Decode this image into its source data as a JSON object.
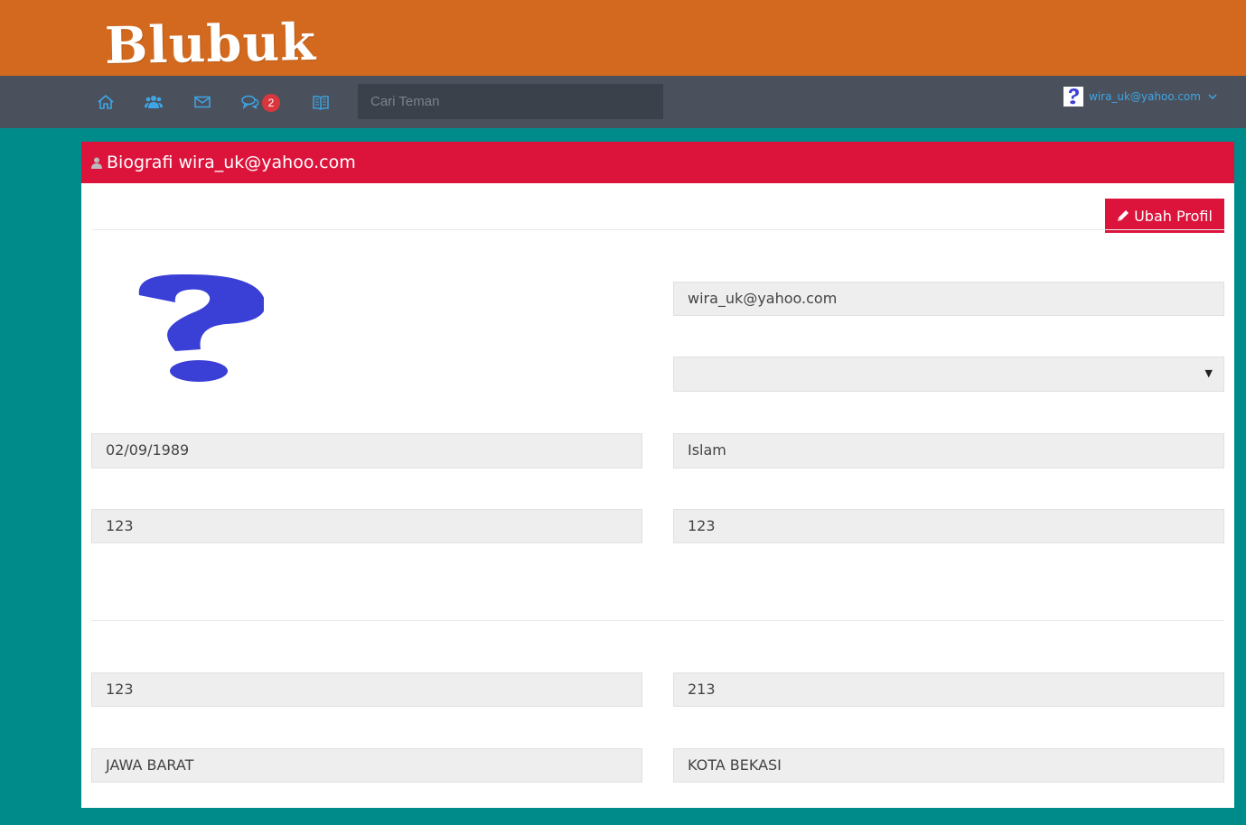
{
  "brand": {
    "logo_text": "Blubuk",
    "topbar_color": "#d2691e"
  },
  "nav": {
    "icons": [
      "home-icon",
      "users-icon",
      "mail-icon",
      "chat-icon",
      "book-icon"
    ],
    "chat_badge": "2",
    "search": {
      "placeholder": "Cari Teman",
      "value": ""
    },
    "user": {
      "name": "wira_uk@yahoo.com",
      "avatar": "question-mark-icon"
    }
  },
  "profile": {
    "header_title": "Biografi wira_uk@yahoo.com",
    "header_color": "#dc143c",
    "edit_button": "Ubah Profil",
    "photo": "question-mark-image",
    "email": "wira_uk@yahoo.com",
    "gender_select": "",
    "birth_date": "02/09/1989",
    "religion": "Islam",
    "field_left_1": "123",
    "field_right_1": "123",
    "field_left_2": "123",
    "field_right_2": "213",
    "province": "JAWA BARAT",
    "city": "KOTA BEKASI"
  },
  "colors": {
    "page_background": "#008b8b",
    "navbar": "#4a515c",
    "link": "#3ea5e6"
  }
}
